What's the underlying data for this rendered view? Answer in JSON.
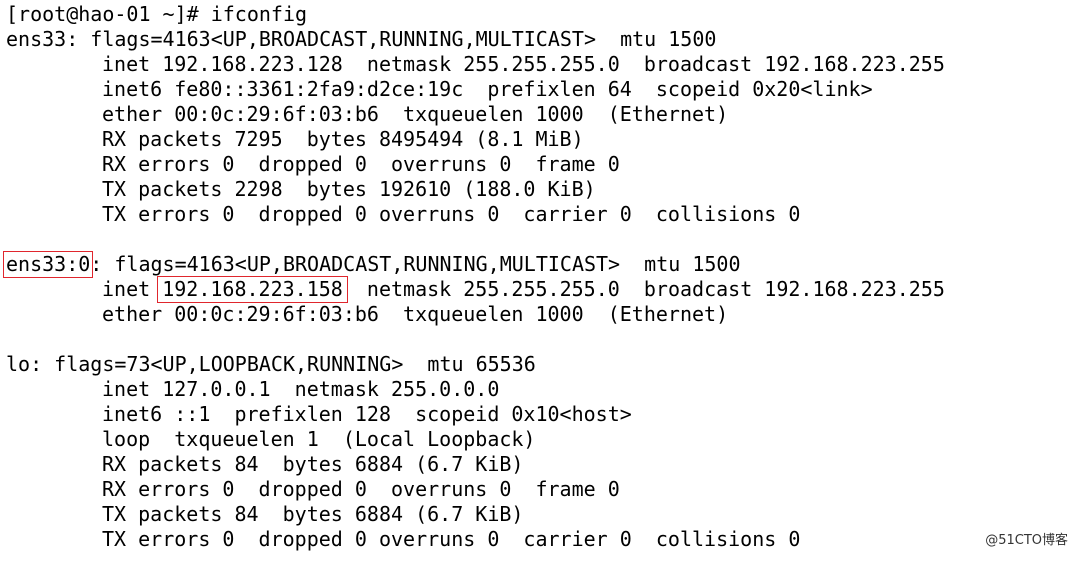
{
  "terminal": {
    "prompt": "[root@hao-01 ~]# ifconfig",
    "ens33": {
      "header_name": "ens33:",
      "header_flags": " flags=4163<UP,BROADCAST,RUNNING,MULTICAST>  mtu 1500",
      "inet": "inet 192.168.223.128  netmask 255.255.255.0  broadcast 192.168.223.255",
      "inet6": "inet6 fe80::3361:2fa9:d2ce:19c  prefixlen 64  scopeid 0x20<link>",
      "ether": "ether 00:0c:29:6f:03:b6  txqueuelen 1000  (Ethernet)",
      "rx_packets": "RX packets 7295  bytes 8495494 (8.1 MiB)",
      "rx_errors": "RX errors 0  dropped 0  overruns 0  frame 0",
      "tx_packets": "TX packets 2298  bytes 192610 (188.0 KiB)",
      "tx_errors": "TX errors 0  dropped 0 overruns 0  carrier 0  collisions 0"
    },
    "ens33_0": {
      "header_name": "ens33:0",
      "header_flags": ": flags=4163<UP,BROADCAST,RUNNING,MULTICAST>  mtu 1500",
      "inet_label": "inet ",
      "inet_ip": "192.168.223.158",
      "inet_rest": "  netmask 255.255.255.0  broadcast 192.168.223.255",
      "ether": "ether 00:0c:29:6f:03:b6  txqueuelen 1000  (Ethernet)"
    },
    "lo": {
      "header": "lo: flags=73<UP,LOOPBACK,RUNNING>  mtu 65536",
      "inet": "inet 127.0.0.1  netmask 255.0.0.0",
      "inet6": "inet6 ::1  prefixlen 128  scopeid 0x10<host>",
      "loop": "loop  txqueuelen 1  (Local Loopback)",
      "rx_packets": "RX packets 84  bytes 6884 (6.7 KiB)",
      "rx_errors": "RX errors 0  dropped 0  overruns 0  frame 0",
      "tx_packets": "TX packets 84  bytes 6884 (6.7 KiB)",
      "tx_errors": "TX errors 0  dropped 0 overruns 0  carrier 0  collisions 0"
    }
  },
  "watermark": "@51CTO博客"
}
